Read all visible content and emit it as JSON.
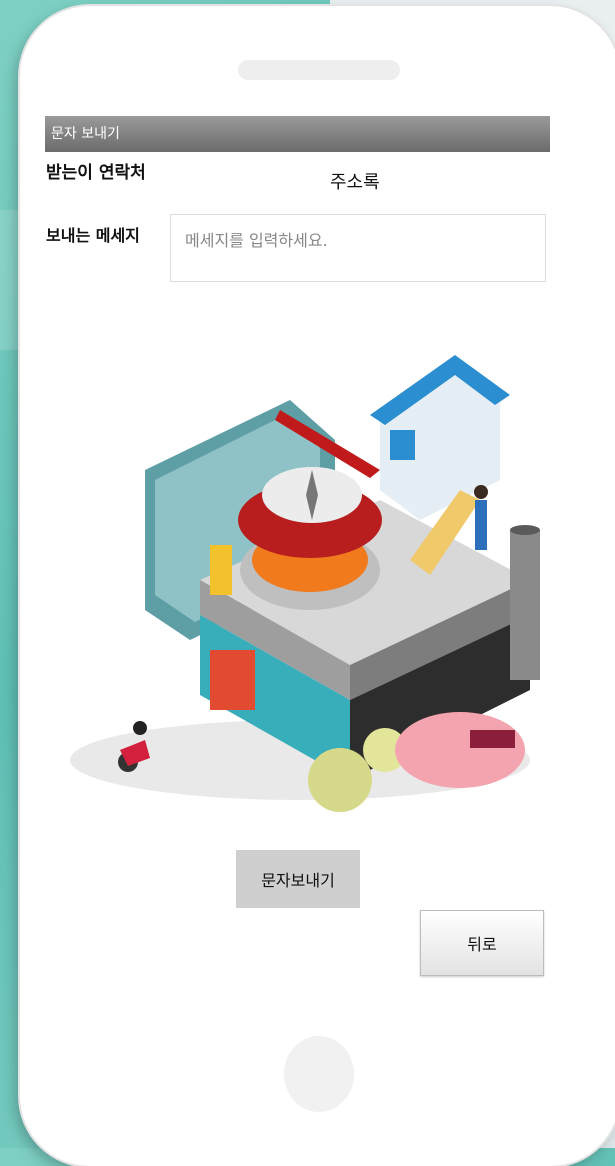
{
  "app": {
    "title": "문자 보내기"
  },
  "form": {
    "recipient_label": "받는이 연락처",
    "address_book_label": "주소록",
    "message_label": "보내는 메세지",
    "message_value": "",
    "message_placeholder": "메세지를 입력하세요."
  },
  "buttons": {
    "send_label": "문자보내기",
    "back_label": "뒤로"
  },
  "colors": {
    "background": "#6fc8bd",
    "titlebar": "#7a7a7a",
    "send_button": "#cfcfcf"
  }
}
